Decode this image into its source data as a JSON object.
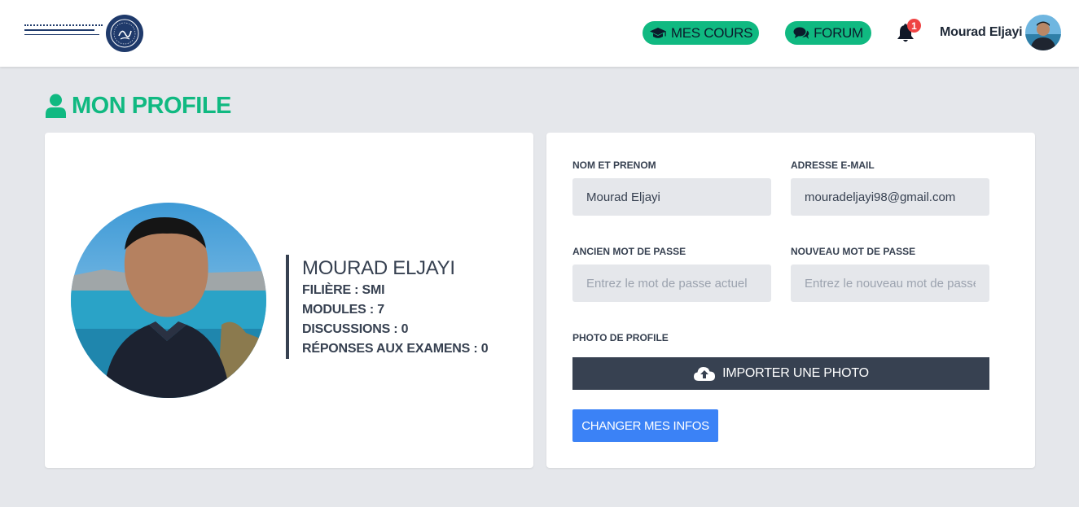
{
  "header": {
    "nav": {
      "courses_label": "MES COURS",
      "forum_label": "FORUM"
    },
    "notifications": {
      "count": "1",
      "icon": "bell-icon"
    },
    "user": {
      "name": "Mourad Eljayi",
      "avatar": "user-avatar"
    },
    "logo": {
      "text": "FACULTE POLYDISCIPLINAIRE DE OUARZAZATE"
    }
  },
  "page": {
    "title": "MON PROFILE",
    "title_icon": "user-icon"
  },
  "profile": {
    "name": "MOURAD ELJAYI",
    "filiere": "FILIÈRE : SMI",
    "modules": "MODULES : 7",
    "discussions": "DISCUSSIONS : 0",
    "reponses": "RÉPONSES AUX EXAMENS : 0"
  },
  "form": {
    "name_label": "NOM ET PRENOM",
    "name_value": "Mourad Eljayi",
    "email_label": "ADRESSE E-MAIL",
    "email_value": "mouradeljayi98@gmail.com",
    "old_password_label": "ANCIEN MOT DE PASSE",
    "old_password_placeholder": "Entrez le mot de passe actuel",
    "new_password_label": "NOUVEAU MOT DE PASSE",
    "new_password_placeholder": "Entrez le nouveau mot de passe",
    "photo_label": "PHOTO DE PROFILE",
    "upload_label": "IMPORTER UNE PHOTO",
    "submit_label": "CHANGER MES INFOS"
  },
  "colors": {
    "accent": "#10b981",
    "dark": "#374151",
    "primary": "#3b82f6",
    "badge": "#ef4444"
  }
}
